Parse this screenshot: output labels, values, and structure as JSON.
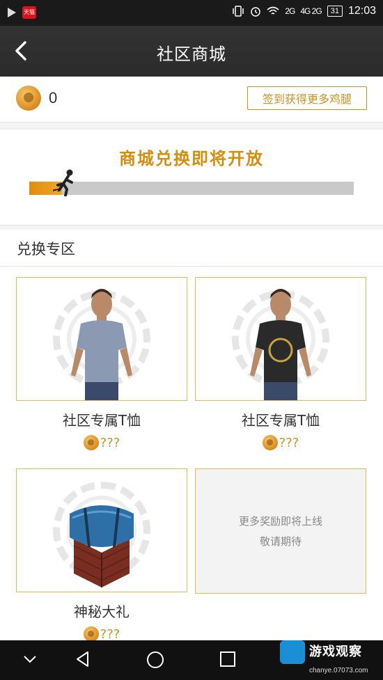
{
  "status_bar": {
    "app_badge": "天猫",
    "signal_1": "2G",
    "signal_2": "4G 2G",
    "battery": "31",
    "time": "12:03"
  },
  "header": {
    "title": "社区商城"
  },
  "points": {
    "count": "0",
    "signin_button": "签到获得更多鸡腿"
  },
  "progress": {
    "headline": "商城兑换即将开放",
    "value": 0.1
  },
  "exchange": {
    "section_title": "兑换专区",
    "items": [
      {
        "name": "社区专属T恤",
        "price": "???",
        "shirt_color": "#8b9ab2"
      },
      {
        "name": "社区专属T恤",
        "price": "???",
        "shirt_color": "#2a2a2a"
      },
      {
        "name": "神秘大礼",
        "price": "???"
      }
    ],
    "coming_soon_line1": "更多奖励即将上线",
    "coming_soon_line2": "敬请期待"
  },
  "watermark": {
    "title": "游戏观察",
    "url": "chanye.07073.com"
  },
  "colors": {
    "accent": "#d58d10",
    "border": "#e2b85a",
    "titlebar": "#2b2b2b"
  }
}
